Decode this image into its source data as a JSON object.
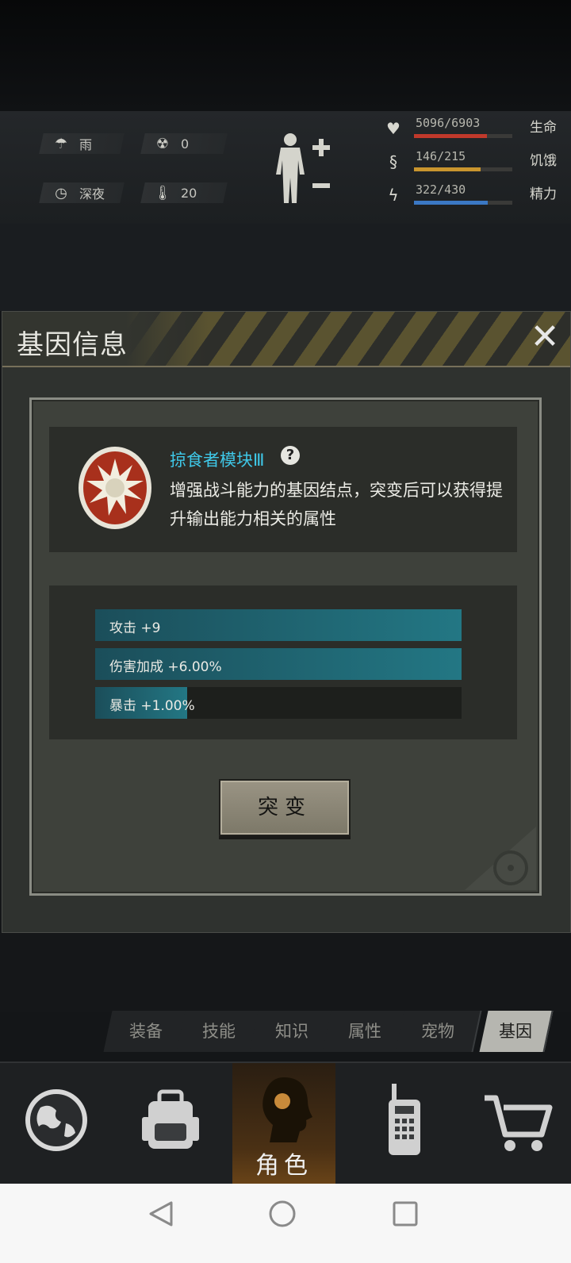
{
  "environment": {
    "weather": "雨",
    "radiation": "0",
    "time_of_day": "深夜",
    "temperature": "20"
  },
  "stats": [
    {
      "label": "生命",
      "value": "5096/6903",
      "fraction": 0.738,
      "color": "#c0392b",
      "icon": "heart-icon"
    },
    {
      "label": "饥饿",
      "value": "146/215",
      "fraction": 0.679,
      "color": "#c9952e",
      "icon": "stomach-icon"
    },
    {
      "label": "精力",
      "value": "322/430",
      "fraction": 0.749,
      "color": "#3b78c4",
      "icon": "energy-icon"
    }
  ],
  "modal": {
    "title": "基因信息",
    "gene_name": "掠食者模块Ⅲ",
    "description": "增强战斗能力的基因结点，突变后可以获得提升输出能力相关的属性",
    "bonuses": [
      {
        "text": "攻击 +9",
        "fraction": 1.0
      },
      {
        "text": "伤害加成 +6.00%",
        "fraction": 1.0
      },
      {
        "text": "暴击 +1.00%",
        "fraction": 0.25
      }
    ],
    "mutate_label": "突变"
  },
  "sub_tabs": [
    "装备",
    "技能",
    "知识",
    "属性",
    "宠物",
    "基因"
  ],
  "active_sub_tab": "基因",
  "bottom_nav": {
    "active_label": "角色",
    "items": [
      "globe-icon",
      "backpack-icon",
      "character-icon",
      "radio-icon",
      "cart-icon"
    ]
  },
  "colors": {
    "accent": "#3fc8e8",
    "bar_fill": "#237784"
  }
}
